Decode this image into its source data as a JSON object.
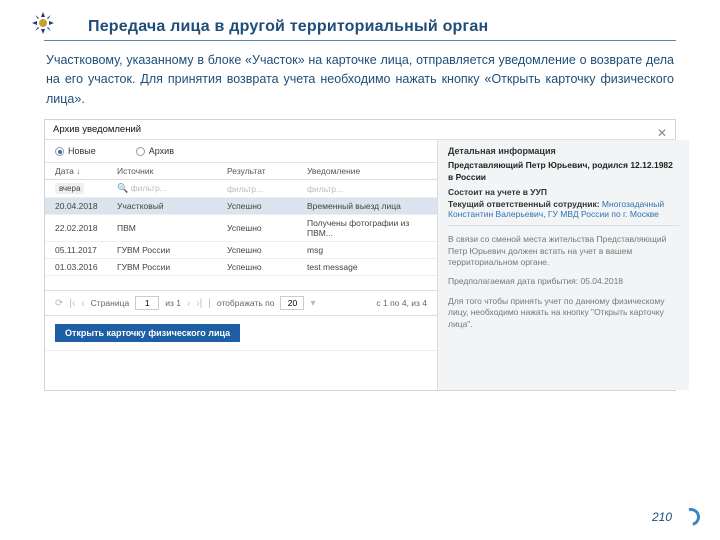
{
  "page_number": "210",
  "title": "Передача лица в другой территориальный орган",
  "instruction": "Участковому, указанному в блоке «Участок» на карточке лица, отправляется уведомление о возврате дела на его участок. Для принятия возврата учета необходимо нажать кнопку «Открыть карточку физического лица».",
  "app": {
    "header": "Архив уведомлений",
    "tabs": {
      "new": "Новые",
      "archive": "Архив"
    },
    "columns": {
      "date": "Дата ↓",
      "source": "Источник",
      "result": "Результат",
      "notice": "Уведомление"
    },
    "filter_tag": "вчера",
    "filter_text": "фильтр...",
    "rows": [
      {
        "date": "20.04.2018",
        "source": "Участковый",
        "result": "Успешно",
        "notice": "Временный выезд лица"
      },
      {
        "date": "22.02.2018",
        "source": "ПВМ",
        "result": "Успешно",
        "notice": "Получены фотографии из ПВМ..."
      },
      {
        "date": "05.11.2017",
        "source": "ГУВМ России",
        "result": "Успешно",
        "notice": "msg"
      },
      {
        "date": "01.03.2016",
        "source": "ГУВМ России",
        "result": "Успешно",
        "notice": "test message"
      }
    ],
    "pager": {
      "page_label": "Страница",
      "page": "1",
      "of": "из 1",
      "per_label": "отображать по",
      "per": "20",
      "count": "с 1 по 4, из 4"
    },
    "open_btn": "Открыть карточку физического лица",
    "right": {
      "title": "Детальная информация",
      "line1": "Представляющий Петр Юрьевич, родился 12.12.1982 в России",
      "status_lab": "Состоит на учете в УУП",
      "resp_lab": "Текущий ответственный сотрудник:",
      "resp_val": " Многозадачный Константин Валерьевич, ГУ МВД России по г. Москве",
      "block1": "В связи со сменой места жительства Представляющий Петр Юрьевич должен встать на учет в вашем территориальном органе.",
      "block2": "Предполагаемая дата прибытия: 05.04.2018",
      "block3": "Для того чтобы принять учет по данному физическому лицу, необходимо нажать на кнопку \"Открыть карточку лица\"."
    }
  }
}
